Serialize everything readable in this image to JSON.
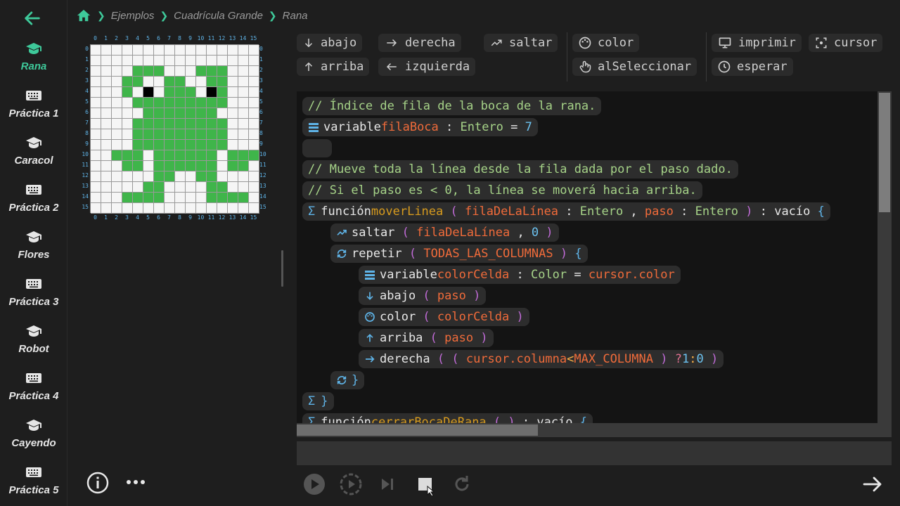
{
  "breadcrumb": {
    "items": [
      "Ejemplos",
      "Cuadrícula Grande",
      "Rana"
    ]
  },
  "sidebar": {
    "items": [
      {
        "label": "Rana",
        "icon": "graduation-cap-icon",
        "active": true
      },
      {
        "label": "Práctica 1",
        "icon": "keyboard-icon"
      },
      {
        "label": "Caracol",
        "icon": "graduation-cap-icon"
      },
      {
        "label": "Práctica 2",
        "icon": "keyboard-icon"
      },
      {
        "label": "Flores",
        "icon": "graduation-cap-icon"
      },
      {
        "label": "Práctica 3",
        "icon": "keyboard-icon"
      },
      {
        "label": "Robot",
        "icon": "graduation-cap-icon"
      },
      {
        "label": "Práctica 4",
        "icon": "keyboard-icon"
      },
      {
        "label": "Cayendo",
        "icon": "graduation-cap-icon"
      },
      {
        "label": "Práctica 5",
        "icon": "keyboard-icon"
      }
    ]
  },
  "grid": {
    "axis_labels": [
      "0",
      "1",
      "2",
      "3",
      "4",
      "5",
      "6",
      "7",
      "8",
      "9",
      "10",
      "11",
      "12",
      "13",
      "14",
      "15"
    ],
    "colors": {
      "g": "#3fb54a",
      "w": "#f5f5f5",
      "k": "#000000"
    },
    "rows": [
      "wwwwwwwwwwwwwwww",
      "wwwwwwwwwwwwwwww",
      "wwwwgggwwwgggwww",
      "wwwggwwggwwggwww",
      "wwwgwkwgggwkgwww",
      "wwwwgggggggggwww",
      "wwwwwgggggggwwww",
      "wwwwgggggggggwww",
      "wwwwgggggggggwww",
      "wwwwgggggggggwww",
      "wwgggwggggggwgggw",
      "wwwggwggggggwggww",
      "wwwwwwggwwggwwww",
      "wwwwwggwwwwggwww",
      "wwwggggwwwwggggw",
      "wwwwwwwwwwwwwwww"
    ]
  },
  "toolbar": {
    "abajo": "abajo",
    "arriba": "arriba",
    "derecha": "derecha",
    "izquierda": "izquierda",
    "saltar": "saltar",
    "color": "color",
    "alSeleccionar": "alSeleccionar",
    "imprimir": "imprimir",
    "esperar": "esperar",
    "cursor": "cursor"
  },
  "code": {
    "l1": "// Índice de fila de la boca de la rana.",
    "l2_kw": "variable",
    "l2_id": "filaBoca",
    "l2_colon": " : ",
    "l2_ty": "Entero",
    "l2_eq": " = ",
    "l2_num": "7",
    "l4": "// Mueve toda la línea desde la fila dada por el paso dado.",
    "l5": "// Si el paso es < 0, la línea se moverá hacia arriba.",
    "l6_kw": "función",
    "l6_fn": "moverLinea",
    "l6_p1": "filaDeLaLínea",
    "l6_t1": "Entero",
    "l6_p2": "paso",
    "l6_t2": "Entero",
    "l6_ret": "vacío",
    "l7_kw": "saltar",
    "l7_a1": "filaDeLaLínea",
    "l7_a2": "0",
    "l8_kw": "repetir",
    "l8_a": "TODAS_LAS_COLUMNAS",
    "l9_kw": "variable",
    "l9_id": "colorCelda",
    "l9_ty": "Color",
    "l9_val": "cursor.color",
    "l10_kw": "abajo",
    "l10_a": "paso",
    "l11_kw": "color",
    "l11_a": "colorCelda",
    "l12_kw": "arriba",
    "l12_a": "paso",
    "l13_kw": "derecha",
    "l13_a1": "cursor.columna",
    "l13_op": "<",
    "l13_a2": "MAX_COLUMNA",
    "l13_q": "?",
    "l13_n1": "1",
    "l13_c": ":",
    "l13_n2": "0",
    "l14": "}",
    "l15": "}",
    "l16_kw": "función",
    "l16_fn": "cerrarBocaDeRana",
    "l16_ret": "vacío"
  },
  "colors": {
    "accent": "#3ec99a",
    "editor_bg": "#141414",
    "line_bg": "#2d2d2d"
  }
}
